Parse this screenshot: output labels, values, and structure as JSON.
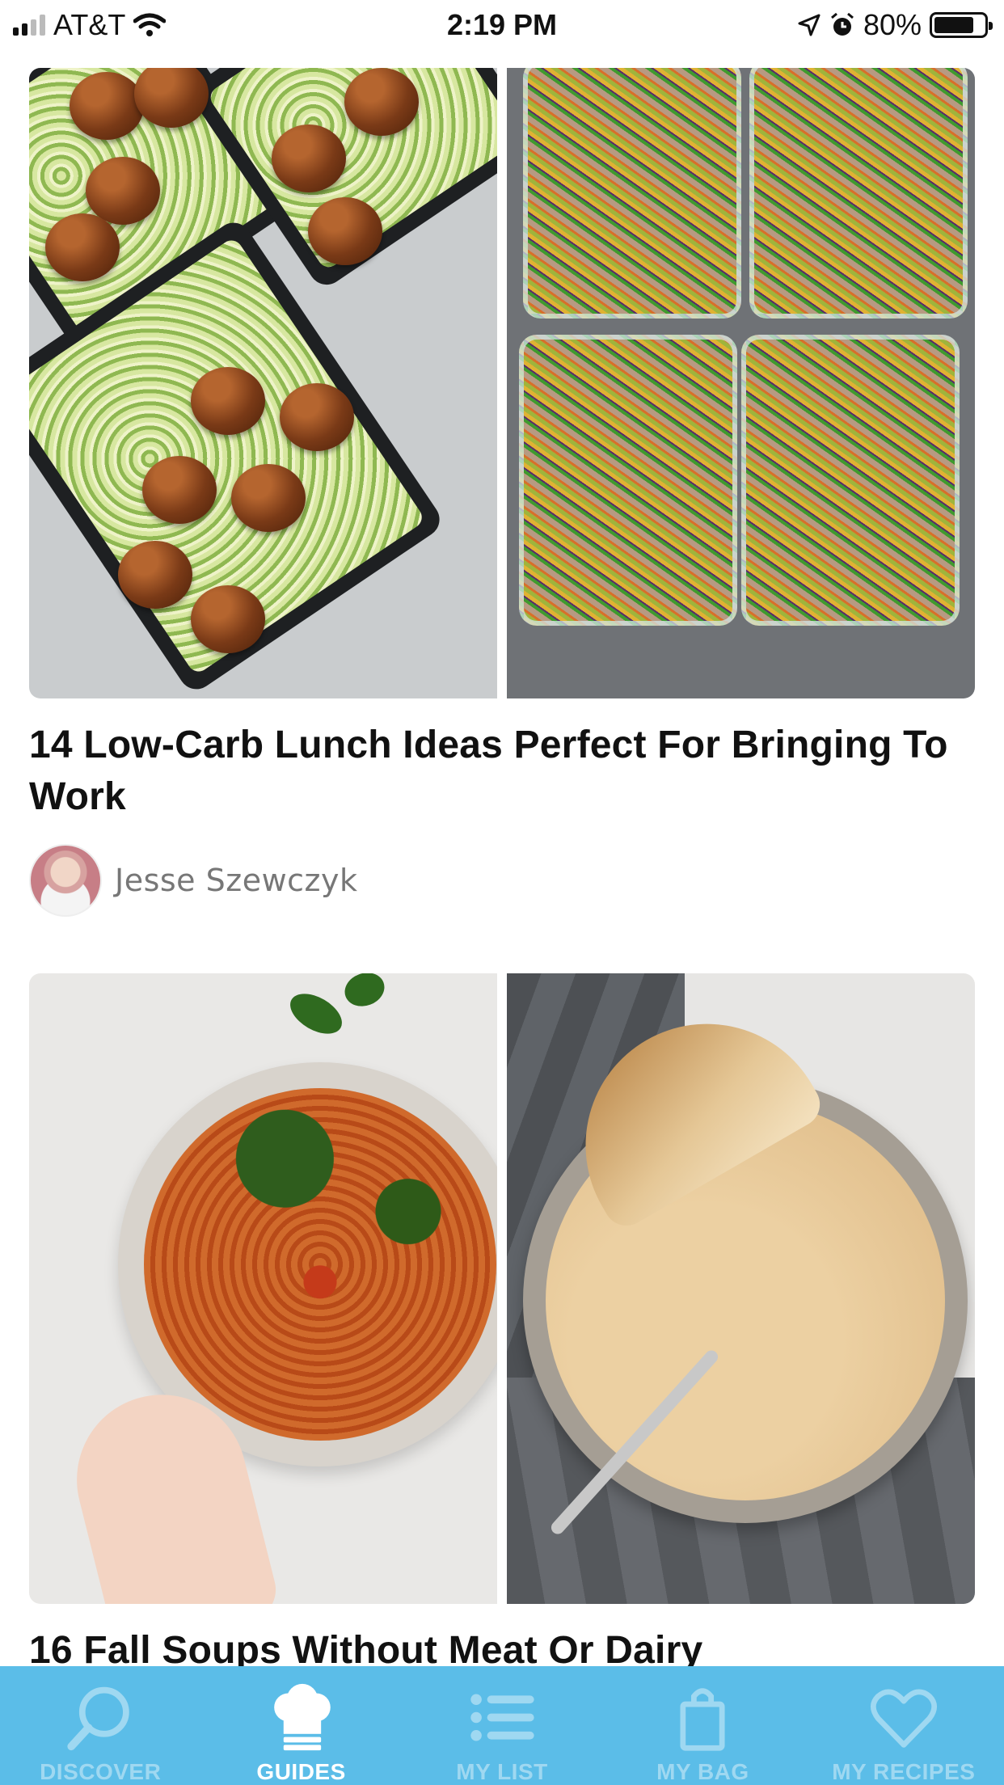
{
  "status_bar": {
    "carrier": "AT&T",
    "time": "2:19 PM",
    "battery_percent": "80%",
    "battery_level": 0.8,
    "icons": [
      "signal-icon",
      "wifi-icon",
      "location-icon",
      "alarm-icon",
      "battery-icon"
    ]
  },
  "feed": {
    "cards": [
      {
        "title": "14 Low-Carb Lunch Ideas Perfect For Bringing To Work",
        "author": "Jesse Szewczyk"
      },
      {
        "title": "16 Fall Soups Without Meat Or Dairy"
      }
    ]
  },
  "tab_bar": {
    "active_color": "#ffffff",
    "inactive_color": "#9fd8f1",
    "background": "#5bbde8",
    "tabs": [
      {
        "label": "DISCOVER",
        "icon": "search-icon",
        "active": false
      },
      {
        "label": "GUIDES",
        "icon": "chef-hat-icon",
        "active": true
      },
      {
        "label": "MY LIST",
        "icon": "list-icon",
        "active": false
      },
      {
        "label": "MY BAG",
        "icon": "shopping-bag-icon",
        "active": false
      },
      {
        "label": "MY RECIPES",
        "icon": "heart-icon",
        "active": false
      }
    ]
  }
}
